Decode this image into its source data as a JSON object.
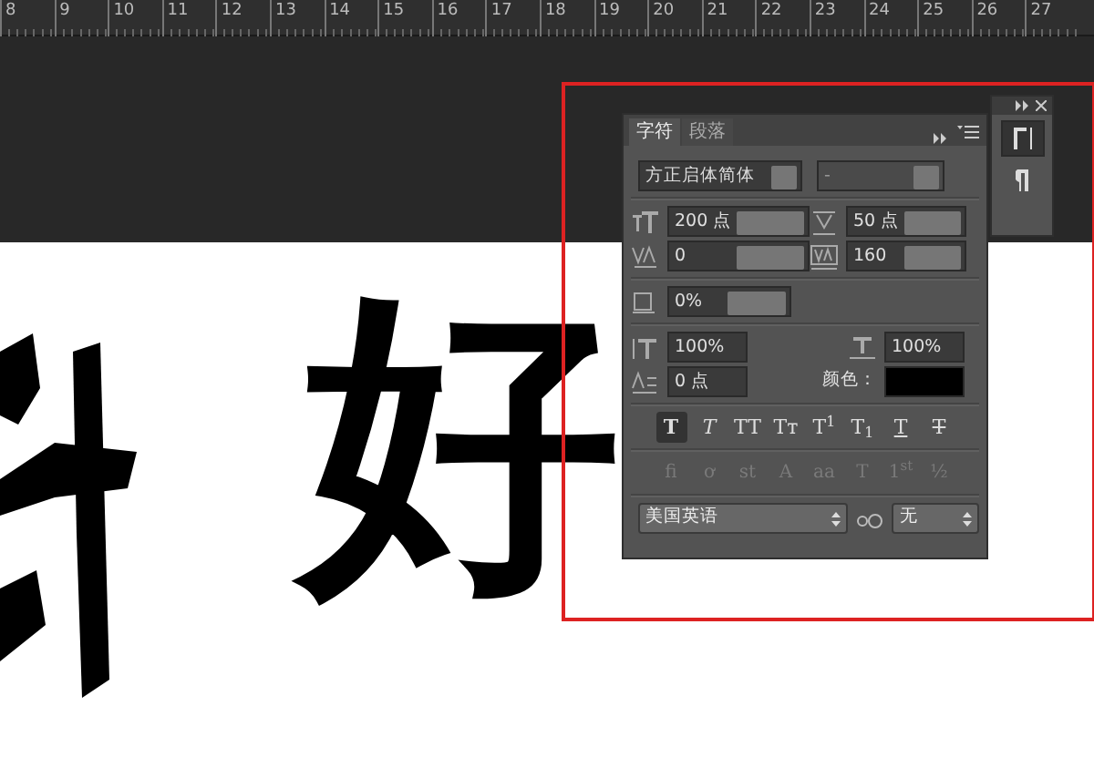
{
  "ruler": {
    "ticks": [
      "8",
      "9",
      "10",
      "11",
      "12",
      "13",
      "14",
      "15",
      "16",
      "17",
      "18",
      "19",
      "20",
      "21",
      "22",
      "23",
      "24",
      "25",
      "26",
      "27"
    ]
  },
  "canvas_text": "好",
  "character_panel": {
    "tabs": [
      {
        "label": "字符",
        "selected": true
      },
      {
        "label": "段落",
        "selected": false
      }
    ],
    "font_family": {
      "value": "方正启体简体"
    },
    "font_style": {
      "value": "-",
      "disabled": true
    },
    "font_size": {
      "value": "200 点"
    },
    "leading": {
      "value": "50 点"
    },
    "kerning": {
      "value": "0"
    },
    "tracking": {
      "value": "160"
    },
    "tsume": {
      "value": "0%"
    },
    "vertical_scale": {
      "value": "100%"
    },
    "horizontal_scale": {
      "value": "100%"
    },
    "baseline_shift": {
      "value": "0 点"
    },
    "color": {
      "label": "颜色：",
      "color": "#000000"
    },
    "style_buttons": [
      {
        "label": "T",
        "kind": "bold",
        "selected": true
      },
      {
        "label": "T",
        "kind": "italic",
        "selected": false
      },
      {
        "label": "TT",
        "kind": "caps",
        "selected": false
      },
      {
        "label": "Tт",
        "kind": "smallcaps",
        "selected": false
      },
      {
        "label": "T$^{1}$",
        "kind": "plain",
        "selected": false
      },
      {
        "label": "T$_{1}$",
        "kind": "plain",
        "selected": false
      },
      {
        "label": "T",
        "kind": "underline",
        "selected": false
      },
      {
        "label": "T",
        "kind": "strike",
        "selected": false
      }
    ],
    "opentype_buttons": [
      {
        "label": "fi",
        "disabled": true
      },
      {
        "label": "ơ",
        "disabled": true
      },
      {
        "label": "st",
        "disabled": true
      },
      {
        "label": "A",
        "disabled": true
      },
      {
        "label": "aa",
        "disabled": true
      },
      {
        "label": "T",
        "disabled": true
      },
      {
        "label": "1$^{st}$",
        "disabled": true
      },
      {
        "label": "½",
        "disabled": true
      }
    ],
    "language": {
      "value": "美国英语"
    },
    "anti_alias": {
      "value": "无"
    }
  },
  "dock": {
    "buttons": [
      {
        "kind": "character",
        "selected": true
      },
      {
        "kind": "paragraph",
        "selected": false
      }
    ]
  }
}
